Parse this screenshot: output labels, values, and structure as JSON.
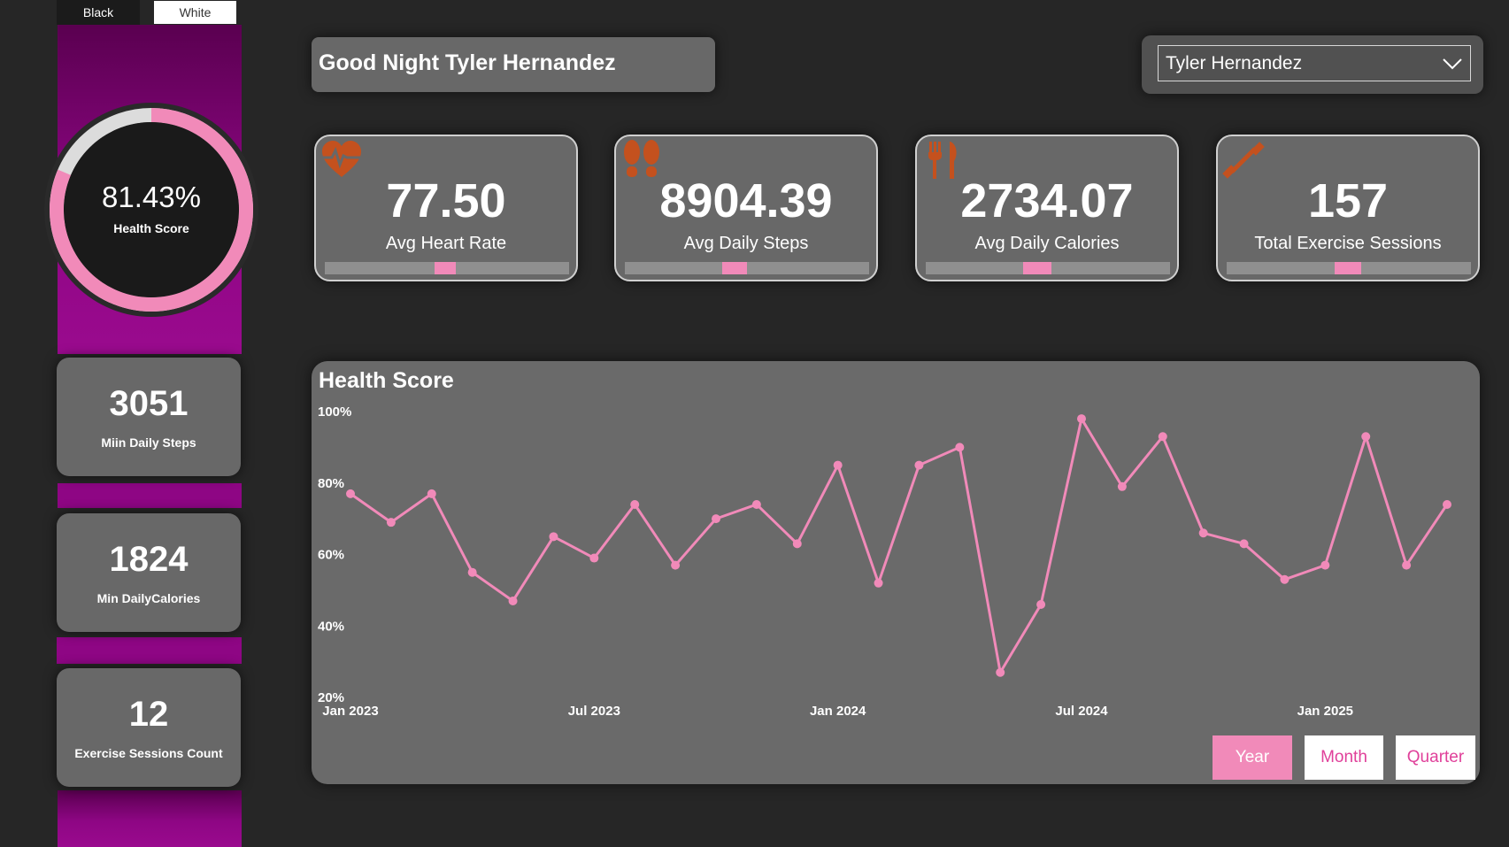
{
  "theme": {
    "black_label": "Black",
    "white_label": "White"
  },
  "health_gauge": {
    "value_label": "81.43%",
    "fraction": 0.8143,
    "label": "Health Score"
  },
  "left_stats": {
    "min_steps": {
      "value": "3051",
      "label": "Miin Daily Steps"
    },
    "min_calories": {
      "value": "1824",
      "label": "Min DailyCalories"
    },
    "exercise_count": {
      "value": "12",
      "label": "Exercise Sessions Count"
    }
  },
  "greeting": "Good Night Tyler Hernandez",
  "user_select": {
    "selected": "Tyler Hernandez"
  },
  "kpis": {
    "heart_rate": {
      "value": "77.50",
      "label": "Avg Heart Rate",
      "icon": "heart-pulse-icon"
    },
    "steps": {
      "value": "8904.39",
      "label": "Avg Daily Steps",
      "icon": "footprints-icon"
    },
    "calories": {
      "value": "2734.07",
      "label": "Avg Daily Calories",
      "icon": "fork-knife-icon"
    },
    "exercise": {
      "value": "157",
      "label": "Total Exercise Sessions",
      "icon": "dumbbell-icon"
    }
  },
  "period_buttons": {
    "year": "Year",
    "month": "Month",
    "quarter": "Quarter"
  },
  "colors": {
    "accent": "#f18ab9",
    "magenta": "#8e0684",
    "icon": "#c4511e",
    "panel": "#686868",
    "background": "#262626"
  },
  "chart_data": {
    "type": "line",
    "title": "Health Score",
    "xlabel": "",
    "ylabel": "",
    "ylim": [
      20,
      100
    ],
    "y_ticks": [
      "100%",
      "80%",
      "60%",
      "40%",
      "20%"
    ],
    "x_ticks": [
      "Jan 2023",
      "Jul 2023",
      "Jan 2024",
      "Jul 2024",
      "Jan 2025"
    ],
    "grid": false,
    "series": [
      {
        "x": [
          "2023-01",
          "2023-02",
          "2023-03",
          "2023-04",
          "2023-05",
          "2023-06",
          "2023-07",
          "2023-08",
          "2023-09",
          "2023-10",
          "2023-11",
          "2023-12",
          "2024-01",
          "2024-02",
          "2024-03",
          "2024-04",
          "2024-05",
          "2024-06",
          "2024-07",
          "2024-08",
          "2024-09",
          "2024-10",
          "2024-11",
          "2024-12",
          "2025-01",
          "2025-02",
          "2025-03",
          "2025-04"
        ],
        "values": [
          77,
          69,
          77,
          55,
          47,
          65,
          59,
          74,
          57,
          70,
          74,
          63,
          85,
          52,
          85,
          90,
          27,
          46,
          98,
          79,
          93,
          66,
          63,
          53,
          57,
          93,
          57,
          74
        ]
      }
    ]
  }
}
